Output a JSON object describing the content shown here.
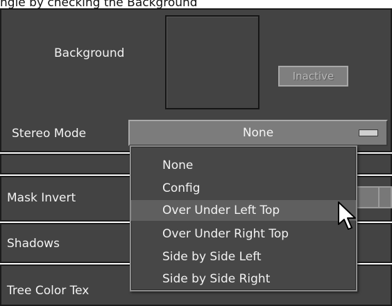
{
  "top_caption": "ngle by checking the Background",
  "background_label": "Background",
  "inactive_button": "Inactive",
  "stereo_mode": {
    "label": "Stereo Mode",
    "selected": "None",
    "options": [
      {
        "label": "None",
        "highlighted": false
      },
      {
        "label": "Config",
        "highlighted": false
      },
      {
        "label": "Over Under Left Top",
        "highlighted": true
      },
      {
        "label": "Over Under Right Top",
        "highlighted": false
      },
      {
        "label": "Side by Side Left",
        "highlighted": false
      },
      {
        "label": "Side by Side Right",
        "highlighted": false
      }
    ]
  },
  "rows": {
    "mask_invert": "Mask Invert",
    "shadows": "Shadows",
    "tree_color_text": "Tree Color Tex"
  },
  "colors": {
    "panel_bg": "#434343",
    "highlight": "#5f5f5f",
    "border": "#1b1b1b"
  }
}
